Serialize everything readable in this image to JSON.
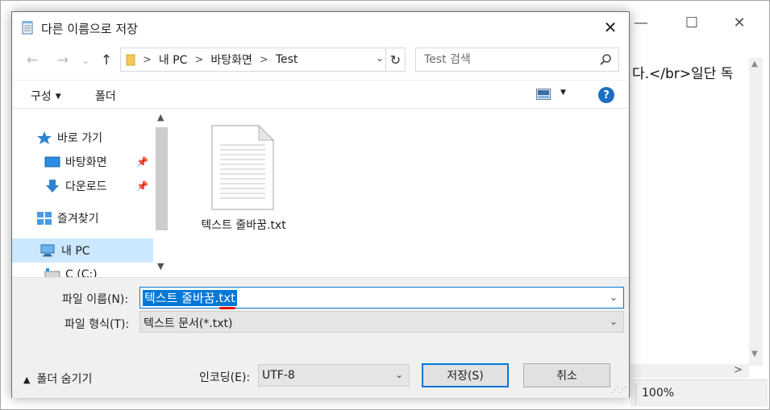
{
  "background_window": {
    "minimize_glyph": "—",
    "maximize_glyph": "☐",
    "close_glyph": "✕",
    "editor_text": "다.</br>일단 독",
    "zoom": "100%",
    "scroll_right_glyph": ">"
  },
  "dialog": {
    "title": "다른 이름으로 저장",
    "close_glyph": "✕",
    "nav": {
      "back_glyph": "←",
      "forward_glyph": "→",
      "dropdown_glyph": "⌄",
      "up_glyph": "↑"
    },
    "address": {
      "crumbs": [
        "내 PC",
        "바탕화면",
        "Test"
      ],
      "separator": ">",
      "refresh_glyph": "↻",
      "dropdown_glyph": "⌄"
    },
    "search": {
      "placeholder": "Test 검색"
    },
    "toolbar": {
      "organize_label": "구성",
      "new_folder_label": "폴더",
      "help_label": "?"
    },
    "nav_pane": {
      "quick_access": "바로 가기",
      "desktop": "바탕화면",
      "downloads": "다운로드",
      "favorites": "즐겨찾기",
      "this_pc": "내 PC",
      "drive_c": "C (C:)",
      "pin_glyph": "📌"
    },
    "files": [
      {
        "name": "텍스트 줄바꿈.txt",
        "icon": "text-file-icon"
      }
    ],
    "form": {
      "filename_label": "파일 이름(N):",
      "filename_value": "텍스트 줄바꿈.txt",
      "filetype_label": "파일 형식(T):",
      "filetype_value": "텍스트 문서(*.txt)",
      "hide_folders_label": "폴더 숨기기",
      "encoding_label": "인코딩(E):",
      "encoding_value": "UTF-8",
      "save_label": "저장(S)",
      "cancel_label": "취소"
    }
  },
  "colors": {
    "accent": "#0078d7",
    "selection_bg": "#cce8ff",
    "help_blue": "#1d6ec2",
    "footer_bg": "#f0f0f0"
  }
}
